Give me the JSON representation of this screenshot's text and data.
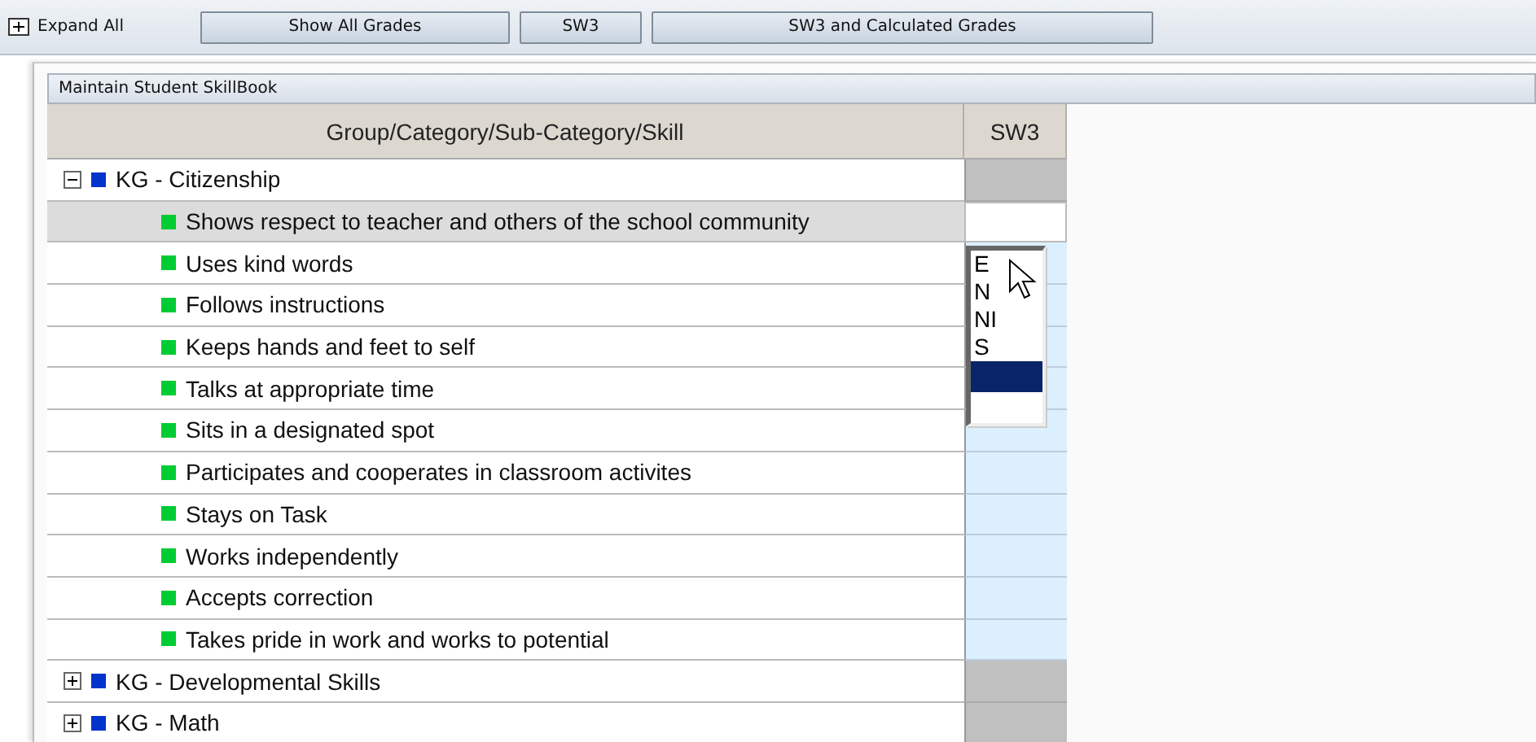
{
  "toolbar": {
    "expand_all": "Expand All",
    "buttons": [
      "Show All Grades",
      "SW3",
      "SW3 and Calculated Grades"
    ]
  },
  "panel": {
    "title": "Maintain Student SkillBook"
  },
  "table": {
    "columns": [
      "Group/Category/Sub-Category/Skill",
      "SW3"
    ],
    "groups": [
      {
        "label": "KG - Citizenship",
        "expanded": true,
        "color": "#0033cc",
        "children": [
          {
            "label": "Shows respect to teacher and others of the school community",
            "selected": true
          },
          {
            "label": "Uses kind words",
            "selected": false
          },
          {
            "label": "Follows instructions",
            "selected": false
          },
          {
            "label": "Keeps hands and feet to self",
            "selected": false
          },
          {
            "label": "Talks at appropriate time",
            "selected": false
          },
          {
            "label": "Sits in a designated spot",
            "selected": false
          },
          {
            "label": "Participates and cooperates in classroom activites",
            "selected": false
          },
          {
            "label": "Stays on Task",
            "selected": false
          },
          {
            "label": "Works independently",
            "selected": false
          },
          {
            "label": "Accepts correction",
            "selected": false
          },
          {
            "label": "Takes pride in work and works to potential",
            "selected": false
          }
        ]
      },
      {
        "label": "KG - Developmental Skills",
        "expanded": false,
        "color": "#0033cc"
      },
      {
        "label": "KG - Math",
        "expanded": false,
        "color": "#0033cc"
      }
    ]
  },
  "grade_list": {
    "options": [
      {
        "label": "E",
        "selected": false
      },
      {
        "label": "N",
        "selected": false
      },
      {
        "label": "NI",
        "selected": false
      },
      {
        "label": "S",
        "selected": false
      }
    ],
    "blank_selected": true
  }
}
